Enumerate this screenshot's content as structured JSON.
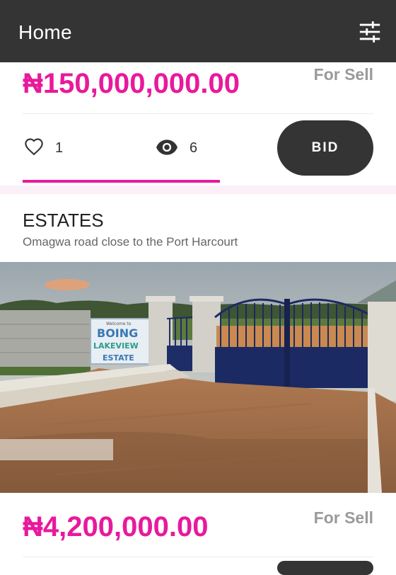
{
  "appbar": {
    "title": "Home",
    "filter_icon": "tune-sliders-icon"
  },
  "listing1": {
    "price": "₦150,000,000.00",
    "badge": "For Sell",
    "likes": "1",
    "views": "6",
    "bid_label": "BID"
  },
  "listing2": {
    "title": "ESTATES",
    "address": "Omagwa road close to the Port Harcourt",
    "image_sign_text": "Welcome to BOING LAKEVIEW ESTATE",
    "price": "₦4,200,000.00",
    "badge": "For Sell"
  },
  "colors": {
    "appbar": "#343434",
    "accent": "#e8199c",
    "badge": "#9a9a9a"
  }
}
